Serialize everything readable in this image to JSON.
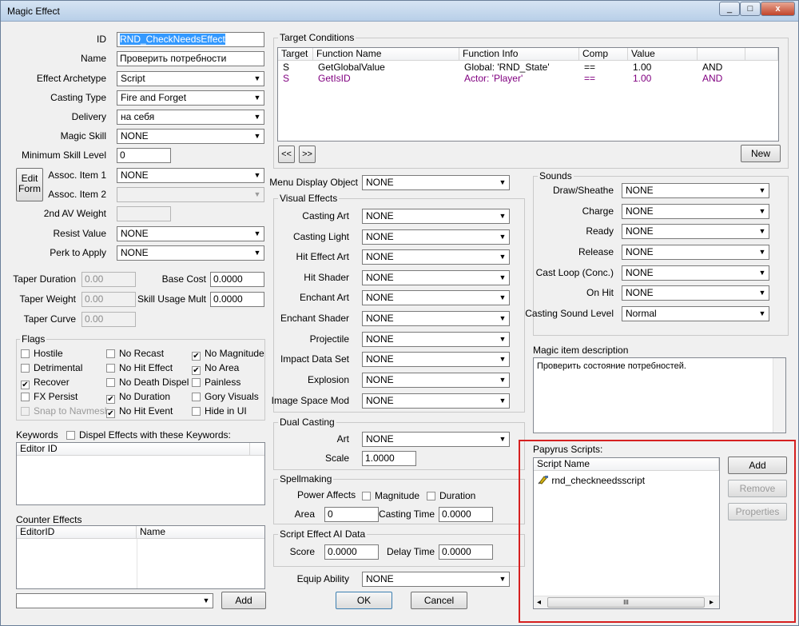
{
  "window": {
    "title": "Magic Effect",
    "min": "_",
    "max": "□",
    "close": "x"
  },
  "left": {
    "id_label": "ID",
    "id_value": "RND_CheckNeedsEffect",
    "name_label": "Name",
    "name_value": "Проверить потребности",
    "archetype_label": "Effect Archetype",
    "archetype_value": "Script",
    "casting_type_label": "Casting Type",
    "casting_type_value": "Fire and Forget",
    "delivery_label": "Delivery",
    "delivery_value": "на себя",
    "magic_skill_label": "Magic Skill",
    "magic_skill_value": "NONE",
    "min_skill_label": "Minimum Skill Level",
    "min_skill_value": "0",
    "edit_form_label": "Edit Form",
    "assoc1_label": "Assoc. Item 1",
    "assoc1_value": "NONE",
    "assoc2_label": "Assoc. Item 2",
    "assoc2_value": "",
    "av_weight_label": "2nd AV Weight",
    "av_weight_value": "",
    "resist_label": "Resist Value",
    "resist_value": "NONE",
    "perk_label": "Perk to Apply",
    "perk_value": "NONE",
    "taper_duration_label": "Taper Duration",
    "taper_duration_value": "0.00",
    "taper_weight_label": "Taper Weight",
    "taper_weight_value": "0.00",
    "taper_curve_label": "Taper Curve",
    "taper_curve_value": "0.00",
    "base_cost_label": "Base Cost",
    "base_cost_value": "0.0000",
    "skill_mult_label": "Skill Usage Mult",
    "skill_mult_value": "0.0000"
  },
  "flags": {
    "title": "Flags",
    "items": [
      {
        "label": "Hostile",
        "mark": ""
      },
      {
        "label": "No Recast",
        "mark": ""
      },
      {
        "label": "No Magnitude",
        "mark": "✔"
      },
      {
        "label": "Detrimental",
        "mark": ""
      },
      {
        "label": "No Hit Effect",
        "mark": ""
      },
      {
        "label": "No Area",
        "mark": "✔"
      },
      {
        "label": "Recover",
        "mark": "✔"
      },
      {
        "label": "No Death Dispel",
        "mark": ""
      },
      {
        "label": "Painless",
        "mark": ""
      },
      {
        "label": "FX Persist",
        "mark": ""
      },
      {
        "label": "No Duration",
        "mark": "✔"
      },
      {
        "label": "Gory Visuals",
        "mark": ""
      },
      {
        "label": "Snap to Navmesh",
        "mark": ""
      },
      {
        "label": "No Hit Event",
        "mark": "✔"
      },
      {
        "label": "Hide in UI",
        "mark": ""
      }
    ]
  },
  "keywords": {
    "label": "Keywords",
    "dispel_label": "Dispel Effects with these Keywords:",
    "col_editor_id": "Editor ID"
  },
  "counter": {
    "label": "Counter Effects",
    "col_editor_id": "EditorID",
    "col_name": "Name",
    "add_label": "Add",
    "dropdown_value": ""
  },
  "target": {
    "title": "Target Conditions",
    "columns": [
      "Target",
      "Function Name",
      "Function Info",
      "Comp",
      "Value"
    ],
    "rows": [
      {
        "target": "S",
        "func": "GetGlobalValue",
        "info": "Global: 'RND_State'",
        "comp": "==",
        "value": "1.00",
        "op": "AND"
      },
      {
        "target": "S",
        "func": "GetIsID",
        "info": "Actor: 'Player'",
        "comp": "==",
        "value": "1.00",
        "op": "AND"
      }
    ],
    "prev_label": "<<",
    "next_label": ">>",
    "new_label": "New"
  },
  "menu_display": {
    "label": "Menu Display Object",
    "value": "NONE"
  },
  "visual": {
    "title": "Visual Effects",
    "items": [
      {
        "label": "Casting Art",
        "value": "NONE"
      },
      {
        "label": "Casting Light",
        "value": "NONE"
      },
      {
        "label": "Hit Effect Art",
        "value": "NONE"
      },
      {
        "label": "Hit Shader",
        "value": "NONE"
      },
      {
        "label": "Enchant Art",
        "value": "NONE"
      },
      {
        "label": "Enchant Shader",
        "value": "NONE"
      },
      {
        "label": "Projectile",
        "value": "NONE"
      },
      {
        "label": "Impact Data Set",
        "value": "NONE"
      },
      {
        "label": "Explosion",
        "value": "NONE"
      },
      {
        "label": "Image Space Mod",
        "value": "NONE"
      }
    ]
  },
  "dual": {
    "title": "Dual Casting",
    "art_label": "Art",
    "art_value": "NONE",
    "scale_label": "Scale",
    "scale_value": "1.0000"
  },
  "spell": {
    "title": "Spellmaking",
    "power_label": "Power Affects",
    "magnitude_label": "Magnitude",
    "duration_label": "Duration",
    "area_label": "Area",
    "area_value": "0",
    "casting_time_label": "Casting Time",
    "casting_time_value": "0.0000"
  },
  "ai": {
    "title": "Script Effect AI Data",
    "score_label": "Score",
    "score_value": "0.0000",
    "delay_label": "Delay Time",
    "delay_value": "0.0000"
  },
  "equip": {
    "label": "Equip Ability",
    "value": "NONE"
  },
  "ok_label": "OK",
  "cancel_label": "Cancel",
  "sounds": {
    "title": "Sounds",
    "items": [
      {
        "label": "Draw/Sheathe",
        "value": "NONE"
      },
      {
        "label": "Charge",
        "value": "NONE"
      },
      {
        "label": "Ready",
        "value": "NONE"
      },
      {
        "label": "Release",
        "value": "NONE"
      },
      {
        "label": "Cast Loop (Conc.)",
        "value": "NONE"
      },
      {
        "label": "On Hit",
        "value": "NONE"
      }
    ],
    "level_label": "Casting Sound Level",
    "level_value": "Normal"
  },
  "description": {
    "label": "Magic item description",
    "text": "Проверить состояние потребностей."
  },
  "papyrus": {
    "title": "Papyrus Scripts:",
    "col_script": "Script Name",
    "script": "rnd_checkneedsscript",
    "add_label": "Add",
    "remove_label": "Remove",
    "properties_label": "Properties",
    "scroll_grip": "III",
    "scroll_left": "◂",
    "scroll_right": "▸"
  },
  "colors": {
    "highlight": "#d62020",
    "selection": "#3399ff",
    "condition_text": "#800080"
  },
  "icons": {
    "script": "script-icon",
    "dropdown": "chevron-down-icon"
  }
}
